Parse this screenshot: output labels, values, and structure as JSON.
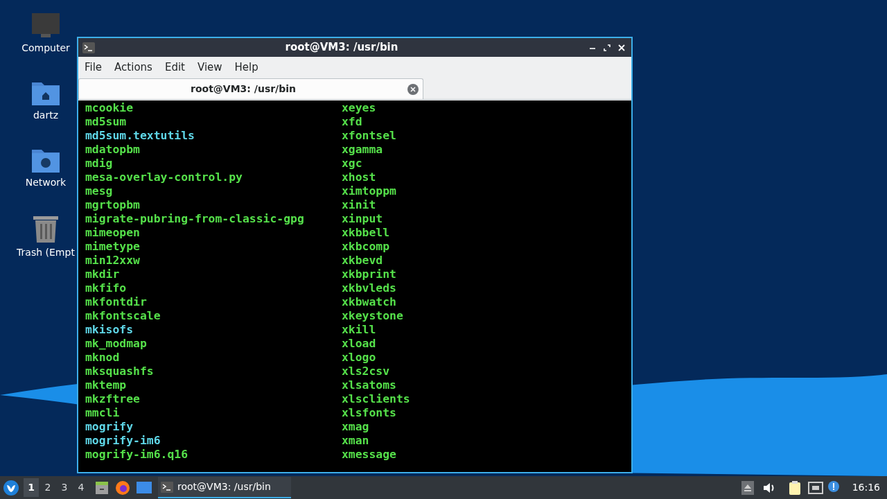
{
  "desktop_icons": [
    {
      "label": "Computer",
      "kind": "computer"
    },
    {
      "label": "dartz",
      "kind": "home"
    },
    {
      "label": "Network",
      "kind": "network"
    },
    {
      "label": "Trash (Empt",
      "kind": "trash"
    }
  ],
  "window": {
    "title": "root@VM3: /usr/bin",
    "menu": [
      "File",
      "Actions",
      "Edit",
      "View",
      "Help"
    ],
    "tabs": [
      {
        "label": "root@VM3: /usr/bin",
        "selected": true
      }
    ],
    "terminal": {
      "columns": [
        [
          {
            "text": "mcookie",
            "kind": "exec"
          },
          {
            "text": "md5sum",
            "kind": "exec"
          },
          {
            "text": "md5sum.textutils",
            "kind": "link"
          },
          {
            "text": "mdatopbm",
            "kind": "exec"
          },
          {
            "text": "mdig",
            "kind": "exec"
          },
          {
            "text": "mesa-overlay-control.py",
            "kind": "exec"
          },
          {
            "text": "mesg",
            "kind": "exec"
          },
          {
            "text": "mgrtopbm",
            "kind": "exec"
          },
          {
            "text": "migrate-pubring-from-classic-gpg",
            "kind": "exec"
          },
          {
            "text": "mimeopen",
            "kind": "exec"
          },
          {
            "text": "mimetype",
            "kind": "exec"
          },
          {
            "text": "min12xxw",
            "kind": "exec"
          },
          {
            "text": "mkdir",
            "kind": "exec"
          },
          {
            "text": "mkfifo",
            "kind": "exec"
          },
          {
            "text": "mkfontdir",
            "kind": "exec"
          },
          {
            "text": "mkfontscale",
            "kind": "exec"
          },
          {
            "text": "mkisofs",
            "kind": "link"
          },
          {
            "text": "mk_modmap",
            "kind": "exec"
          },
          {
            "text": "mknod",
            "kind": "exec"
          },
          {
            "text": "mksquashfs",
            "kind": "exec"
          },
          {
            "text": "mktemp",
            "kind": "exec"
          },
          {
            "text": "mkzftree",
            "kind": "exec"
          },
          {
            "text": "mmcli",
            "kind": "exec"
          },
          {
            "text": "mogrify",
            "kind": "link"
          },
          {
            "text": "mogrify-im6",
            "kind": "link"
          },
          {
            "text": "mogrify-im6.q16",
            "kind": "exec"
          }
        ],
        [
          {
            "text": "xeyes",
            "kind": "exec"
          },
          {
            "text": "xfd",
            "kind": "exec"
          },
          {
            "text": "xfontsel",
            "kind": "exec"
          },
          {
            "text": "xgamma",
            "kind": "exec"
          },
          {
            "text": "xgc",
            "kind": "exec"
          },
          {
            "text": "xhost",
            "kind": "exec"
          },
          {
            "text": "ximtoppm",
            "kind": "exec"
          },
          {
            "text": "xinit",
            "kind": "exec"
          },
          {
            "text": "xinput",
            "kind": "exec"
          },
          {
            "text": "xkbbell",
            "kind": "exec"
          },
          {
            "text": "xkbcomp",
            "kind": "exec"
          },
          {
            "text": "xkbevd",
            "kind": "exec"
          },
          {
            "text": "xkbprint",
            "kind": "exec"
          },
          {
            "text": "xkbvleds",
            "kind": "exec"
          },
          {
            "text": "xkbwatch",
            "kind": "exec"
          },
          {
            "text": "xkeystone",
            "kind": "exec"
          },
          {
            "text": "xkill",
            "kind": "exec"
          },
          {
            "text": "xload",
            "kind": "exec"
          },
          {
            "text": "xlogo",
            "kind": "exec"
          },
          {
            "text": "xls2csv",
            "kind": "exec"
          },
          {
            "text": "xlsatoms",
            "kind": "exec"
          },
          {
            "text": "xlsclients",
            "kind": "exec"
          },
          {
            "text": "xlsfonts",
            "kind": "exec"
          },
          {
            "text": "xmag",
            "kind": "exec"
          },
          {
            "text": "xman",
            "kind": "exec"
          },
          {
            "text": "xmessage",
            "kind": "exec"
          }
        ]
      ]
    }
  },
  "taskbar": {
    "workspaces": [
      {
        "label": "1",
        "selected": true
      },
      {
        "label": "2",
        "selected": false
      },
      {
        "label": "3",
        "selected": false
      },
      {
        "label": "4",
        "selected": false
      }
    ],
    "tasks": [
      {
        "label": "root@VM3: /usr/bin",
        "selected": true
      }
    ],
    "clock": "16:16"
  }
}
